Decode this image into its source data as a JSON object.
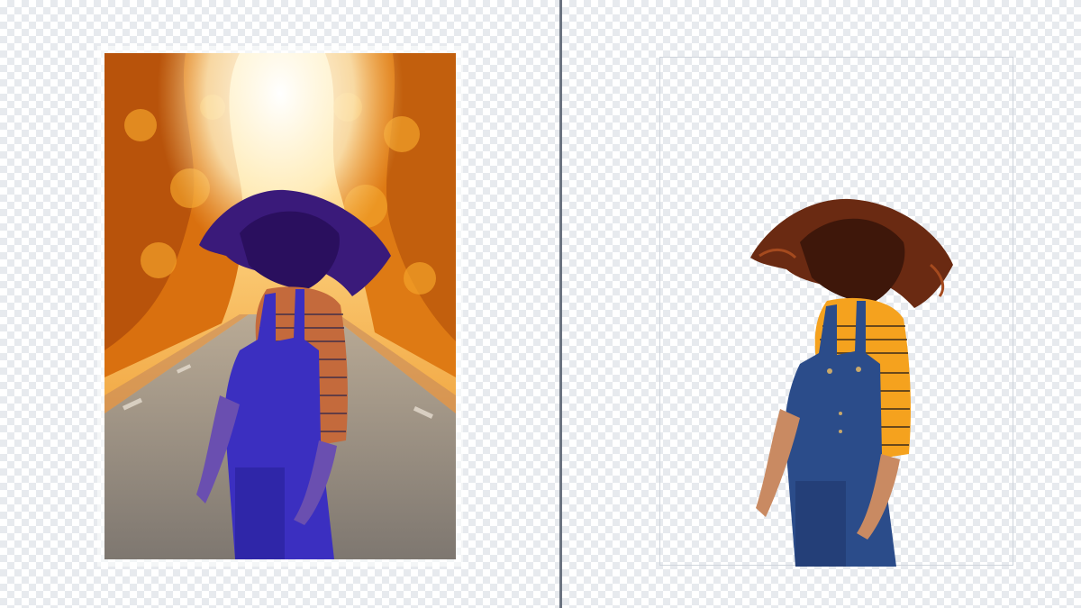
{
  "app": {
    "name": "",
    "mode": "background-removal-preview"
  },
  "panes": {
    "original": {
      "label": "",
      "image": "original-photo-autumn-road-woman-swinging-hair"
    },
    "result": {
      "label": "",
      "image": "cutout-woman-swinging-hair-transparent-background"
    }
  },
  "colors": {
    "checker_light": "#ffffff",
    "checker_dark": "#e7eaee",
    "divider": "#6b7380",
    "foliage": "#e98a18",
    "road": "#8a8278",
    "selection_tint": "#3a1fb0",
    "shirt": "#f5a21e",
    "overalls": "#2b4c8a",
    "hair": "#5a2614"
  },
  "icons": {
    "divider_handle": "split-handle"
  }
}
